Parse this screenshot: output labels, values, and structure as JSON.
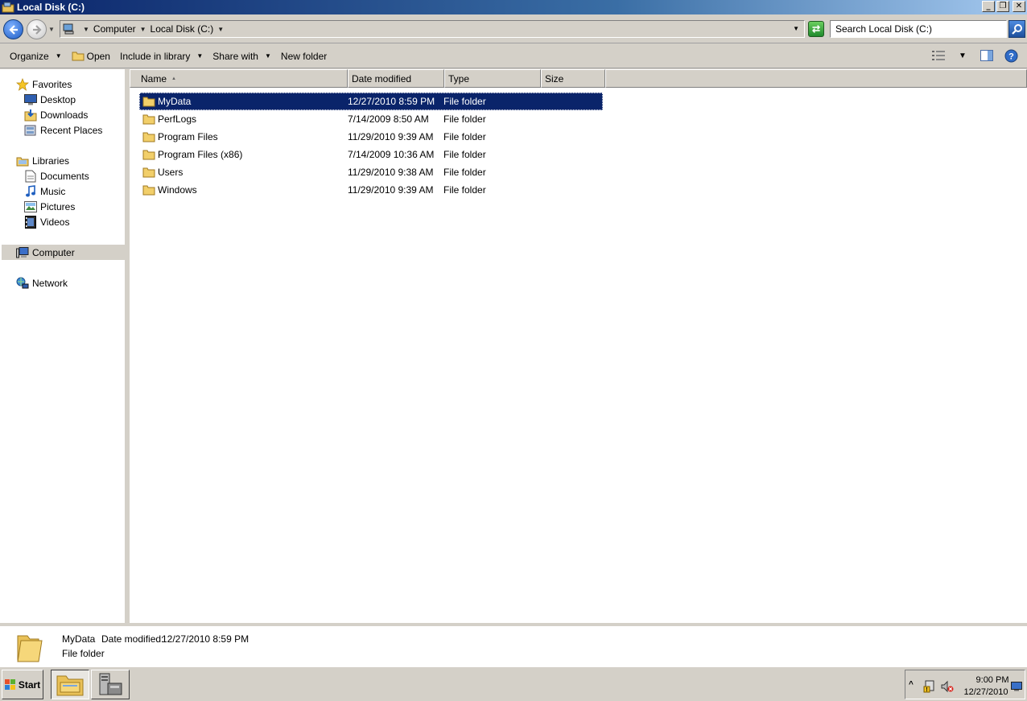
{
  "window": {
    "title": "Local Disk (C:)"
  },
  "window_buttons": {
    "minimize": "_",
    "maximize": "❐",
    "close": "✕"
  },
  "address": {
    "crumbs": [
      "Computer",
      "Local Disk (C:)"
    ]
  },
  "search": {
    "placeholder": "Search Local Disk (C:)"
  },
  "toolbar": {
    "organize": "Organize",
    "open": "Open",
    "include_in_library": "Include in library",
    "share_with": "Share with",
    "new_folder": "New folder"
  },
  "nav": {
    "favorites": "Favorites",
    "desktop": "Desktop",
    "downloads": "Downloads",
    "recent_places": "Recent Places",
    "libraries": "Libraries",
    "documents": "Documents",
    "music": "Music",
    "pictures": "Pictures",
    "videos": "Videos",
    "computer": "Computer",
    "network": "Network"
  },
  "columns": {
    "name": "Name",
    "date_modified": "Date modified",
    "type": "Type",
    "size": "Size"
  },
  "files": [
    {
      "name": "MyData",
      "date": "12/27/2010 8:59 PM",
      "type": "File folder",
      "selected": true
    },
    {
      "name": "PerfLogs",
      "date": "7/14/2009 8:50 AM",
      "type": "File folder"
    },
    {
      "name": "Program Files",
      "date": "11/29/2010 9:39 AM",
      "type": "File folder"
    },
    {
      "name": "Program Files (x86)",
      "date": "7/14/2009 10:36 AM",
      "type": "File folder"
    },
    {
      "name": "Users",
      "date": "11/29/2010 9:38 AM",
      "type": "File folder"
    },
    {
      "name": "Windows",
      "date": "11/29/2010 9:39 AM",
      "type": "File folder"
    }
  ],
  "details": {
    "name": "MyData",
    "date_label": "Date modified:",
    "date_value": "12/27/2010 8:59 PM",
    "type": "File folder"
  },
  "taskbar": {
    "start": "Start",
    "clock_time": "9:00 PM",
    "clock_date": "12/27/2010"
  },
  "colors": {
    "selection": "#0a246a",
    "chrome": "#d4d0c8",
    "titlebar_start": "#0a246a",
    "titlebar_end": "#a6caf0"
  }
}
